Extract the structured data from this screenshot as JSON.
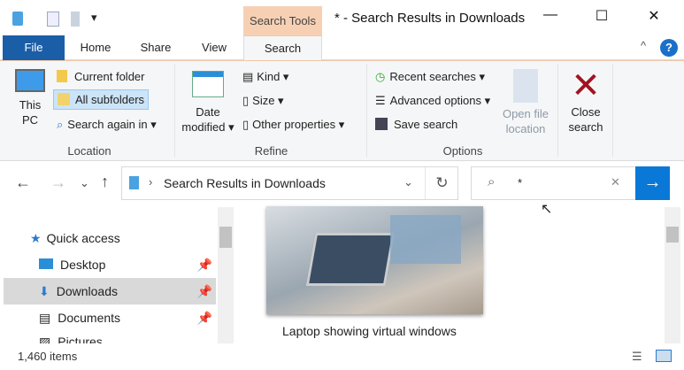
{
  "titlebar": {
    "context_tab": "Search Tools",
    "title": "* - Search Results in Downloads",
    "minimize": "—",
    "maximize": "☐",
    "close": "✕",
    "qat_dropdown": "▾"
  },
  "tabs": [
    "File",
    "Home",
    "Share",
    "View",
    "Search"
  ],
  "ribbon": {
    "location": {
      "label": "Location",
      "this_pc": "This PC",
      "current_folder": "Current folder",
      "all_subfolders": "All subfolders",
      "search_again": "Search again in ▾"
    },
    "refine": {
      "label": "Refine",
      "date_modified": "Date modified ▾",
      "kind": "Kind ▾",
      "size": "Size ▾",
      "other": "Other properties ▾"
    },
    "options": {
      "label": "Options",
      "recent": "Recent searches ▾",
      "advanced": "Advanced options ▾",
      "save": "Save search",
      "open_location": "Open file location"
    },
    "close_search": "Close search"
  },
  "address": {
    "path": "Search Results in Downloads",
    "search_value": "*"
  },
  "nav": {
    "quick_access": "Quick access",
    "items": [
      "Desktop",
      "Downloads",
      "Documents",
      "Pictures"
    ]
  },
  "content": {
    "caption": "Laptop showing virtual windows"
  },
  "status": {
    "count": "1,460 items"
  },
  "colors": {
    "accent": "#0a78d7",
    "file_tab": "#1a5ea8",
    "context": "#f7d0b4"
  }
}
